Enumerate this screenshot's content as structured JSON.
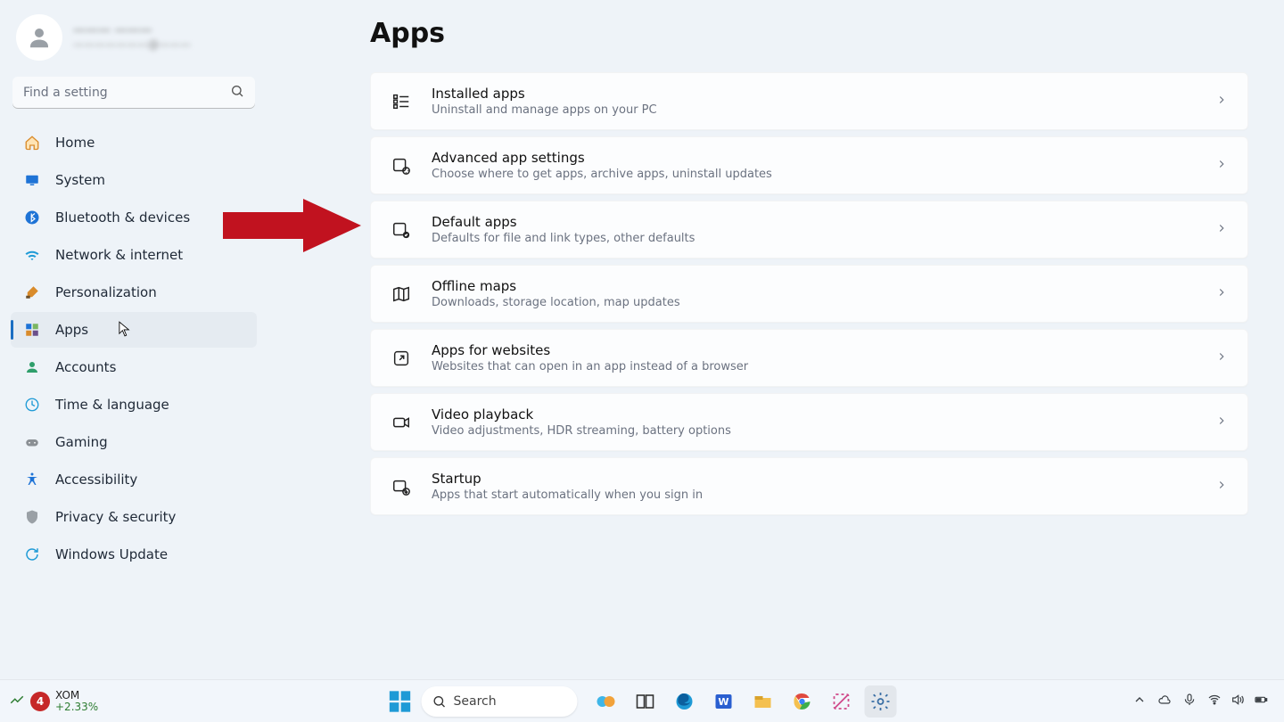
{
  "account": {
    "name_blur": "——— ———",
    "email_blur": "———————@———"
  },
  "search": {
    "placeholder": "Find a setting"
  },
  "sidebar": {
    "items": [
      {
        "label": "Home"
      },
      {
        "label": "System"
      },
      {
        "label": "Bluetooth & devices"
      },
      {
        "label": "Network & internet"
      },
      {
        "label": "Personalization"
      },
      {
        "label": "Apps"
      },
      {
        "label": "Accounts"
      },
      {
        "label": "Time & language"
      },
      {
        "label": "Gaming"
      },
      {
        "label": "Accessibility"
      },
      {
        "label": "Privacy & security"
      },
      {
        "label": "Windows Update"
      }
    ],
    "active_index": 5
  },
  "page": {
    "title": "Apps",
    "cards": [
      {
        "title": "Installed apps",
        "desc": "Uninstall and manage apps on your PC"
      },
      {
        "title": "Advanced app settings",
        "desc": "Choose where to get apps, archive apps, uninstall updates"
      },
      {
        "title": "Default apps",
        "desc": "Defaults for file and link types, other defaults"
      },
      {
        "title": "Offline maps",
        "desc": "Downloads, storage location, map updates"
      },
      {
        "title": "Apps for websites",
        "desc": "Websites that can open in an app instead of a browser"
      },
      {
        "title": "Video playback",
        "desc": "Video adjustments, HDR streaming, battery options"
      },
      {
        "title": "Startup",
        "desc": "Apps that start automatically when you sign in"
      }
    ]
  },
  "taskbar": {
    "stock": {
      "badge": "4",
      "symbol": "XOM",
      "change": "+2.33%"
    },
    "search_label": "Search"
  }
}
